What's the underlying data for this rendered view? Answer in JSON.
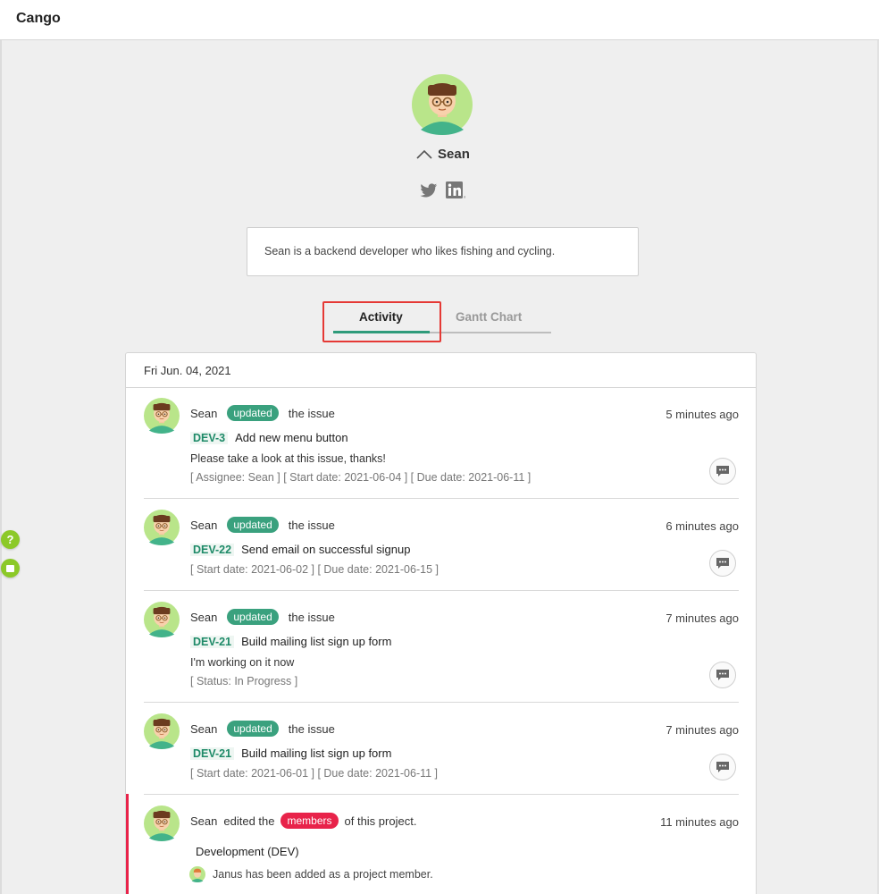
{
  "app": {
    "brand": "Cango"
  },
  "sidebar_buttons": {
    "help_glyph": "?",
    "chat_icon": "chat-bubble-icon"
  },
  "profile": {
    "name": "Sean",
    "toggle_icon": "chevron-up-icon",
    "socials": [
      "twitter-icon",
      "linkedin-icon"
    ],
    "bio": "Sean is a backend developer who likes fishing and cycling."
  },
  "tabs": [
    {
      "label": "Activity",
      "active": true
    },
    {
      "label": "Gantt Chart",
      "active": false
    }
  ],
  "feed": {
    "date": "Fri Jun. 04, 2021",
    "entries": [
      {
        "user": "Sean",
        "action_badge": "updated",
        "action_suffix": "the issue",
        "time": "5 minutes ago",
        "issue_key": "DEV-3",
        "issue_title": "Add new menu button",
        "note": "Please take a look at this issue, thanks!",
        "meta": "[ Assignee: Sean ] [ Start date: 2021-06-04 ] [ Due date: 2021-06-11 ]"
      },
      {
        "user": "Sean",
        "action_badge": "updated",
        "action_suffix": "the issue",
        "time": "6 minutes ago",
        "issue_key": "DEV-22",
        "issue_title": "Send email on successful signup",
        "meta": "[ Start date: 2021-06-02 ] [ Due date: 2021-06-15 ]"
      },
      {
        "user": "Sean",
        "action_badge": "updated",
        "action_suffix": "the issue",
        "time": "7 minutes ago",
        "issue_key": "DEV-21",
        "issue_title": "Build mailing list sign up form",
        "note": "I'm working on it now",
        "meta": "[ Status: In Progress ]"
      },
      {
        "user": "Sean",
        "action_badge": "updated",
        "action_suffix": "the issue",
        "time": "7 minutes ago",
        "issue_key": "DEV-21",
        "issue_title": "Build mailing list sign up form",
        "meta": "[ Start date: 2021-06-01 ] [ Due date: 2021-06-11 ]"
      },
      {
        "user": "Sean",
        "action_prefix": "edited the",
        "action_badge": "members",
        "action_suffix": "of this project.",
        "time": "11 minutes ago",
        "project": "Development (DEV)",
        "member_note": "Janus has been added as a project member."
      }
    ]
  },
  "colors": {
    "accent_green": "#3aa17e",
    "badge_red": "#e8234a",
    "side_button_green": "#8cc928",
    "highlight_red": "#e53935"
  }
}
